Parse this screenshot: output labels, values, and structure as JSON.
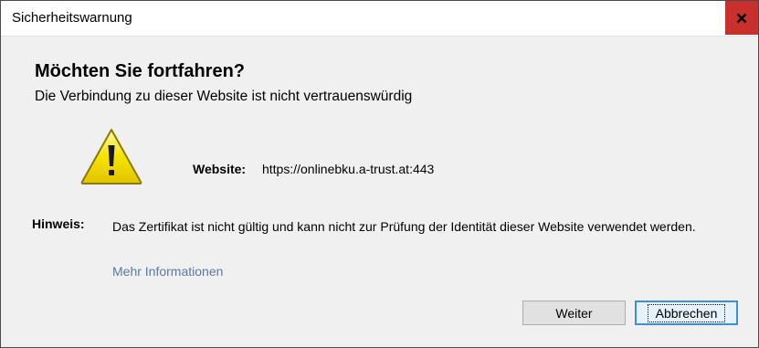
{
  "window": {
    "title": "Sicherheitswarnung",
    "close_label": "x"
  },
  "main": {
    "heading": "Möchten Sie fortfahren?",
    "subheading": "Die Verbindung zu dieser Website ist nicht vertrauenswürdig",
    "warning_icon": "warning-triangle-icon",
    "website_label": "Website:",
    "website_value": "https://onlinebku.a-trust.at:443",
    "hint_label": "Hinweis:",
    "hint_text": "Das Zertifikat ist nicht gültig und kann nicht zur Prüfung der Identität dieser Website verwendet werden.",
    "more_info": "Mehr Informationen"
  },
  "buttons": {
    "continue_label": "Weiter",
    "cancel_label": "Abbrechen"
  },
  "colors": {
    "close_bg": "#c9302c",
    "link": "#5b7a9f",
    "focus_border": "#3c8fd6",
    "warning_yellow": "#f5e400"
  }
}
